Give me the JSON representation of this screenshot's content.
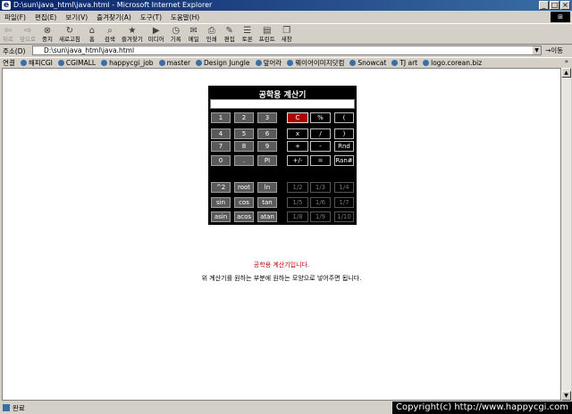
{
  "window": {
    "title": "D:\\sun\\java_html\\java.html - Microsoft Internet Explorer",
    "buttons": [
      "_",
      "□",
      "×"
    ]
  },
  "menu": {
    "items": [
      "파일(F)",
      "편집(E)",
      "보기(V)",
      "즐겨찾기(A)",
      "도구(T)",
      "도움말(H)"
    ]
  },
  "toolbar": {
    "buttons": [
      {
        "label": "뒤로",
        "icon": "back-arrow-icon",
        "glyph": "⇦",
        "disabled": true
      },
      {
        "label": "앞으로",
        "icon": "forward-arrow-icon",
        "glyph": "⇨",
        "disabled": true
      },
      {
        "label": "중지",
        "icon": "stop-icon",
        "glyph": "⊗",
        "disabled": false
      },
      {
        "label": "새로고침",
        "icon": "refresh-icon",
        "glyph": "↻",
        "disabled": false
      },
      {
        "label": "홈",
        "icon": "home-icon",
        "glyph": "⌂",
        "disabled": false
      },
      {
        "label": "검색",
        "icon": "search-icon",
        "glyph": "⌕",
        "disabled": false
      },
      {
        "label": "즐겨찾기",
        "icon": "favorites-icon",
        "glyph": "★",
        "disabled": false
      },
      {
        "label": "미디어",
        "icon": "media-icon",
        "glyph": "▶",
        "disabled": false
      },
      {
        "label": "기록",
        "icon": "history-icon",
        "glyph": "◷",
        "disabled": false
      },
      {
        "label": "메일",
        "icon": "mail-icon",
        "glyph": "✉",
        "disabled": false
      },
      {
        "label": "인쇄",
        "icon": "print-icon",
        "glyph": "⎙",
        "disabled": false
      },
      {
        "label": "편집",
        "icon": "edit-icon",
        "glyph": "✎",
        "disabled": false
      },
      {
        "label": "토론",
        "icon": "discuss-icon",
        "glyph": "☰",
        "disabled": false
      },
      {
        "label": "프린트",
        "icon": "printer-icon",
        "glyph": "▤",
        "disabled": false
      },
      {
        "label": "새창",
        "icon": "new-window-icon",
        "glyph": "❐",
        "disabled": false
      }
    ]
  },
  "address": {
    "label": "주소(D)",
    "value": "D:\\sun\\java_html\\java.html",
    "go_label": "→이동"
  },
  "links": {
    "label": "연결",
    "items": [
      "해피CGI",
      "CGIMALL",
      "happycgi_job",
      "master",
      "Design Jungle",
      "앞어라",
      "웨이어이미지닷컴",
      "Snowcat",
      "TJ art",
      "logo.corean.biz"
    ],
    "more": "»"
  },
  "calculator": {
    "title": "공학용 계산기",
    "display_value": "",
    "rows": [
      [
        {
          "t": "1",
          "k": "num"
        },
        {
          "t": "2",
          "k": "num"
        },
        {
          "t": "3",
          "k": "num"
        },
        {
          "t": "C",
          "k": "red"
        },
        {
          "t": "%",
          "k": "op"
        },
        {
          "t": "(",
          "k": "op"
        }
      ],
      [
        {
          "t": "4",
          "k": "num"
        },
        {
          "t": "5",
          "k": "num"
        },
        {
          "t": "6",
          "k": "num"
        },
        {
          "t": "x",
          "k": "op"
        },
        {
          "t": "/",
          "k": "op"
        },
        {
          "t": ")",
          "k": "op"
        }
      ],
      [
        {
          "t": "7",
          "k": "num"
        },
        {
          "t": "8",
          "k": "num"
        },
        {
          "t": "9",
          "k": "num"
        },
        {
          "t": "+",
          "k": "op"
        },
        {
          "t": "-",
          "k": "op"
        },
        {
          "t": "Rnd",
          "k": "op"
        }
      ],
      [
        {
          "t": "0",
          "k": "num"
        },
        {
          "t": ".",
          "k": "num"
        },
        {
          "t": "PI",
          "k": "num"
        },
        {
          "t": "+/-",
          "k": "op"
        },
        {
          "t": "=",
          "k": "op"
        },
        {
          "t": "Ran#",
          "k": "op"
        }
      ],
      [
        {
          "t": "^2",
          "k": "num"
        },
        {
          "t": "root",
          "k": "num"
        },
        {
          "t": "ln",
          "k": "num"
        },
        {
          "t": "1/2",
          "k": "frac"
        },
        {
          "t": "1/3",
          "k": "frac"
        },
        {
          "t": "1/4",
          "k": "frac"
        }
      ],
      [
        {
          "t": "sin",
          "k": "num"
        },
        {
          "t": "cos",
          "k": "num"
        },
        {
          "t": "tan",
          "k": "num"
        },
        {
          "t": "1/5",
          "k": "frac"
        },
        {
          "t": "1/6",
          "k": "frac"
        },
        {
          "t": "1/7",
          "k": "frac"
        }
      ],
      [
        {
          "t": "asin",
          "k": "num"
        },
        {
          "t": "acos",
          "k": "num"
        },
        {
          "t": "atan",
          "k": "num"
        },
        {
          "t": "1/8",
          "k": "frac"
        },
        {
          "t": "1/9",
          "k": "frac"
        },
        {
          "t": "1/10",
          "k": "frac"
        }
      ]
    ]
  },
  "messages": {
    "line1": "공학용 계산기입니다.",
    "line2": "위 계산기를 원하는 부분에 원하는 모양으로 넣어주면 됩니다."
  },
  "status": {
    "text": "완료",
    "copyright": "Copyright(c) http://www.happycgi.com"
  },
  "colors": {
    "title_bar": "#0a246a",
    "calc_bg": "#000000",
    "clear_key": "#b00000",
    "message_red": "#c00000"
  }
}
